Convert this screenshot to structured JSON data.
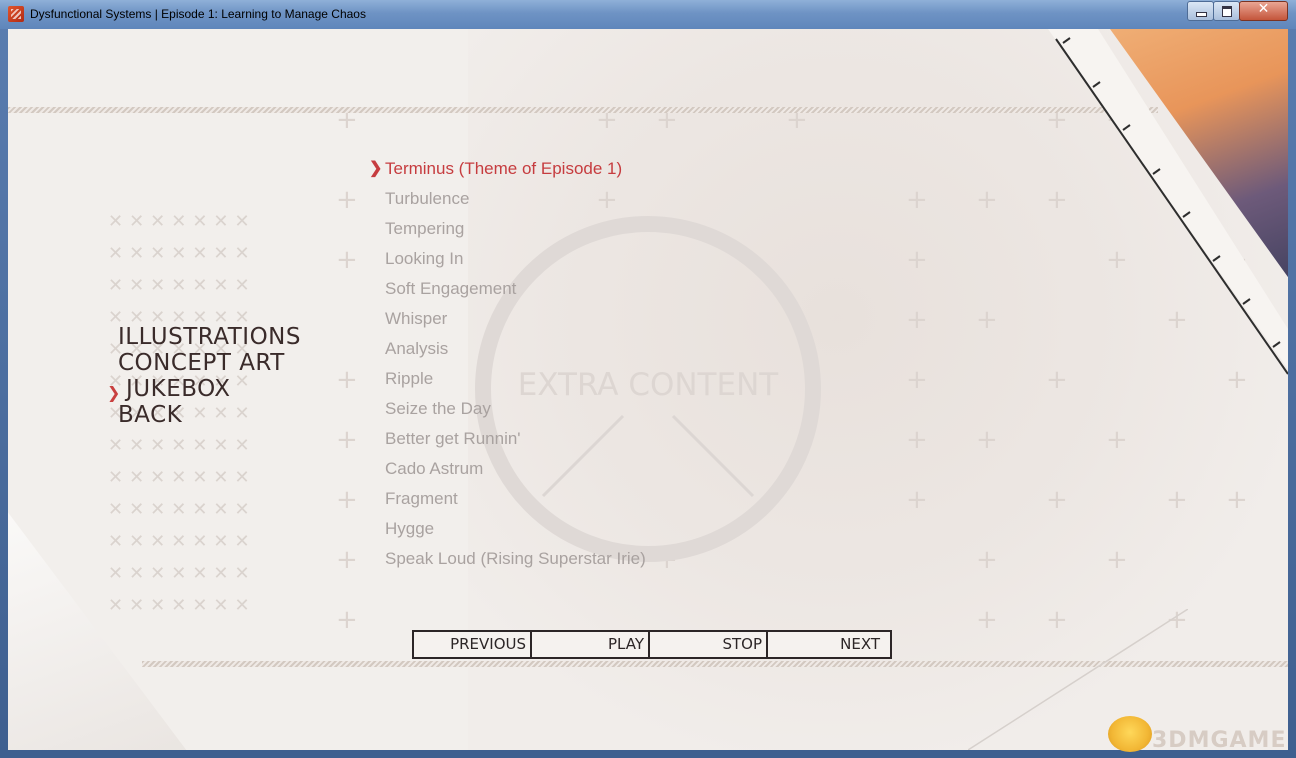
{
  "window": {
    "title": "Dysfunctional Systems | Episode 1: Learning to Manage Chaos",
    "buttons": [
      "minimize",
      "maximize",
      "close"
    ]
  },
  "emblem": {
    "text": "EXTRA CONTENT"
  },
  "menu": {
    "items": [
      {
        "label": "ILLUSTRATIONS",
        "selected": false
      },
      {
        "label": "CONCEPT ART",
        "selected": false
      },
      {
        "label": "JUKEBOX",
        "selected": true
      },
      {
        "label": "BACK",
        "selected": false
      }
    ]
  },
  "tracks": {
    "items": [
      {
        "label": "Terminus (Theme of Episode 1)",
        "selected": true
      },
      {
        "label": "Turbulence",
        "selected": false
      },
      {
        "label": "Tempering",
        "selected": false
      },
      {
        "label": "Looking In",
        "selected": false
      },
      {
        "label": "Soft Engagement",
        "selected": false
      },
      {
        "label": "Whisper",
        "selected": false
      },
      {
        "label": "Analysis",
        "selected": false
      },
      {
        "label": "Ripple",
        "selected": false
      },
      {
        "label": "Seize the Day",
        "selected": false
      },
      {
        "label": "Better get Runnin'",
        "selected": false
      },
      {
        "label": "Cado Astrum",
        "selected": false
      },
      {
        "label": "Fragment",
        "selected": false
      },
      {
        "label": "Hygge",
        "selected": false
      },
      {
        "label": "Speak Loud (Rising Superstar Irie)",
        "selected": false
      }
    ]
  },
  "controls": {
    "previous": "PREVIOUS",
    "play": "PLAY",
    "stop": "STOP",
    "next": "NEXT"
  },
  "watermark": {
    "text": "3DMGAME"
  },
  "colors": {
    "accent": "#c63c3f",
    "menu_text": "#3a2b2a",
    "track_text": "#a9a2a0",
    "background": "#f2efec"
  }
}
